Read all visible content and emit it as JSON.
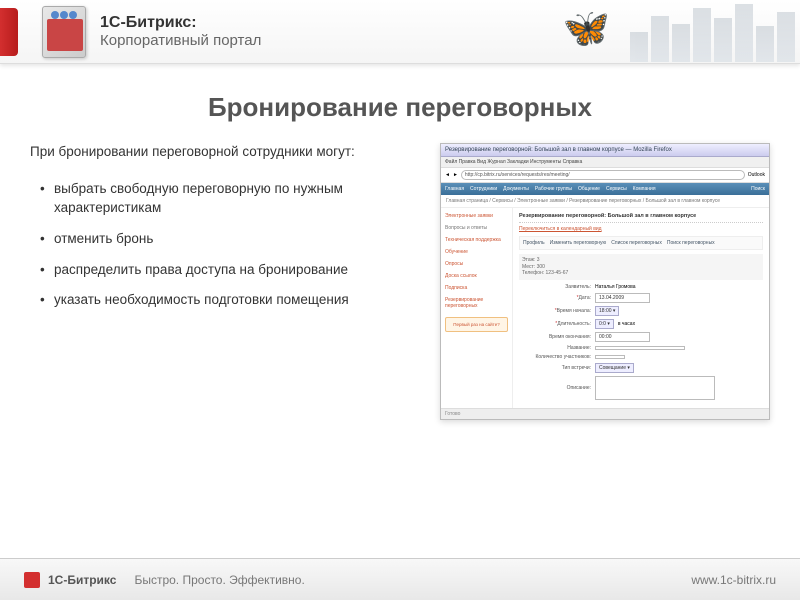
{
  "header": {
    "brand_top": "1С-Битрикс:",
    "brand_bottom": "Корпоративный портал"
  },
  "title": "Бронирование переговорных",
  "intro": "При бронировании переговорной сотрудники могут:",
  "bullets": [
    "выбрать свободную переговорную по нужным характеристикам",
    "отменить бронь",
    "распределить права доступа на бронирование",
    "указать необходимость подготовки помещения"
  ],
  "mock": {
    "window_title": "Резервирование переговорной: Большой зал в главном корпусе — Mozilla Firefox",
    "menu": "Файл  Правка  Вид  Журнал  Закладки  Инструменты  Справка",
    "address": "http://cp.bitrix.ru/services/requests/res/meeting/",
    "go": "Outlook",
    "tabs": [
      "Главная",
      "Сотрудники",
      "Документы",
      "Рабочие группы",
      "Общение",
      "Сервисы",
      "Компания"
    ],
    "search": "Поиск",
    "crumb": "Главная страница / Сервисы / Электронные заявки / Резервирование переговорных / Большой зал в главном корпусе",
    "side": {
      "s1": "Электронные заявки",
      "s2": "Вопросы и ответы",
      "s3": "Техническая поддержка",
      "s4": "Обучение",
      "s5": "Опросы",
      "s6": "Доска ссылок",
      "s7": "Подписка",
      "s8": "Резервирование переговорных",
      "first": "Первый раз на сайте?"
    },
    "main": {
      "title": "Резервирование переговорной: Большой зал в главном корпусе",
      "calendar_link": "Переключиться в календарный вид",
      "toolbar": {
        "a": "Профиль",
        "b": "Изменить переговорную",
        "c": "Список переговорных",
        "d": "Поиск переговорных"
      },
      "info": {
        "etaj": "Этаж: 3",
        "mest": "Мест: 300",
        "tel": "Телефон: 123-45-67"
      },
      "form": {
        "zayavitel_lbl": "Заявитель:",
        "zayavitel_val": "Наталья Громова",
        "data_lbl": "Дата:",
        "data_val": "13.04.2009",
        "vremya_lbl": "Время начала:",
        "vremya_val": "18:00 ▾",
        "dlit_lbl": "Длительность:",
        "dlit_val": "0:0 ▾",
        "dlit_unit": "в часах",
        "okon_lbl": "Время окончания:",
        "okon_val": "00:00",
        "nazv_lbl": "Название:",
        "nazv_val": "",
        "kol_lbl": "Количество участников:",
        "kol_val": "",
        "tip_lbl": "Тип встречи:",
        "tip_val": "Совещание ▾",
        "opis_lbl": "Описание:"
      }
    },
    "status": "Готово"
  },
  "footer": {
    "brand": "1С-Битрикс",
    "tagline": "Быстро. Просто. Эффективно.",
    "url": "www.1c-bitrix.ru"
  }
}
